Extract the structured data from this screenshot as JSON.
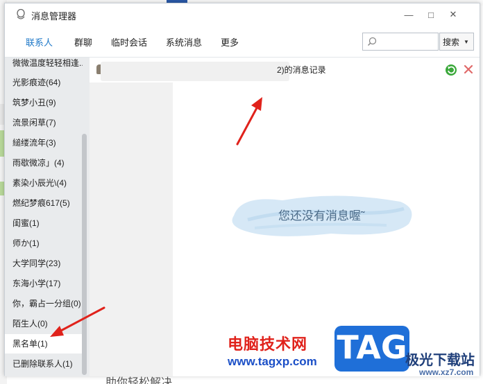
{
  "window": {
    "title": "消息管理器",
    "controls": {
      "minimize": "—",
      "maximize": "□",
      "close": "✕"
    }
  },
  "tabs": [
    {
      "label": "联系人",
      "active": true
    },
    {
      "label": "群聊",
      "active": false
    },
    {
      "label": "临时会话",
      "active": false
    },
    {
      "label": "系统消息",
      "active": false
    },
    {
      "label": "更多",
      "active": false
    }
  ],
  "search": {
    "placeholder": "",
    "button_label": "搜索"
  },
  "sidebar": {
    "groups": [
      {
        "label": "微微温度轻轻相逢..."
      },
      {
        "label": "光影痕迹(64)"
      },
      {
        "label": "筑梦小丑(9)"
      },
      {
        "label": "流景闲草(7)"
      },
      {
        "label": "縋缕流年(3)"
      },
      {
        "label": "雨歇微凉」(4)"
      },
      {
        "label": "素染小辰光\\(4)"
      },
      {
        "label": "燃纪梦痕617(5)"
      },
      {
        "label": "闺蜜(1)"
      },
      {
        "label": "师か(1)"
      },
      {
        "label": "大学同学(23)"
      },
      {
        "label": "东海小学(17)"
      },
      {
        "label": "你，霸占一分组(0)"
      },
      {
        "label": "陌生人(0)"
      },
      {
        "label": "黑名单(1)",
        "selected": true
      },
      {
        "label": "已删除联系人(1)"
      }
    ]
  },
  "record": {
    "title_suffix": "2)的消息记录",
    "empty_message": "您还没有消息喔˜"
  },
  "background": {
    "bottom_text": "助你轻松解决"
  },
  "watermark": {
    "site_name": "电脑技术网",
    "site_url": "www.tagxp.com",
    "logo_text": "TAG",
    "right_text": "极光下载站",
    "right_url": "www.xz7.com"
  },
  "colors": {
    "accent": "#1e78c8",
    "annotation_arrow": "#e0221b",
    "sidebar_bg": "#e9ebed"
  }
}
